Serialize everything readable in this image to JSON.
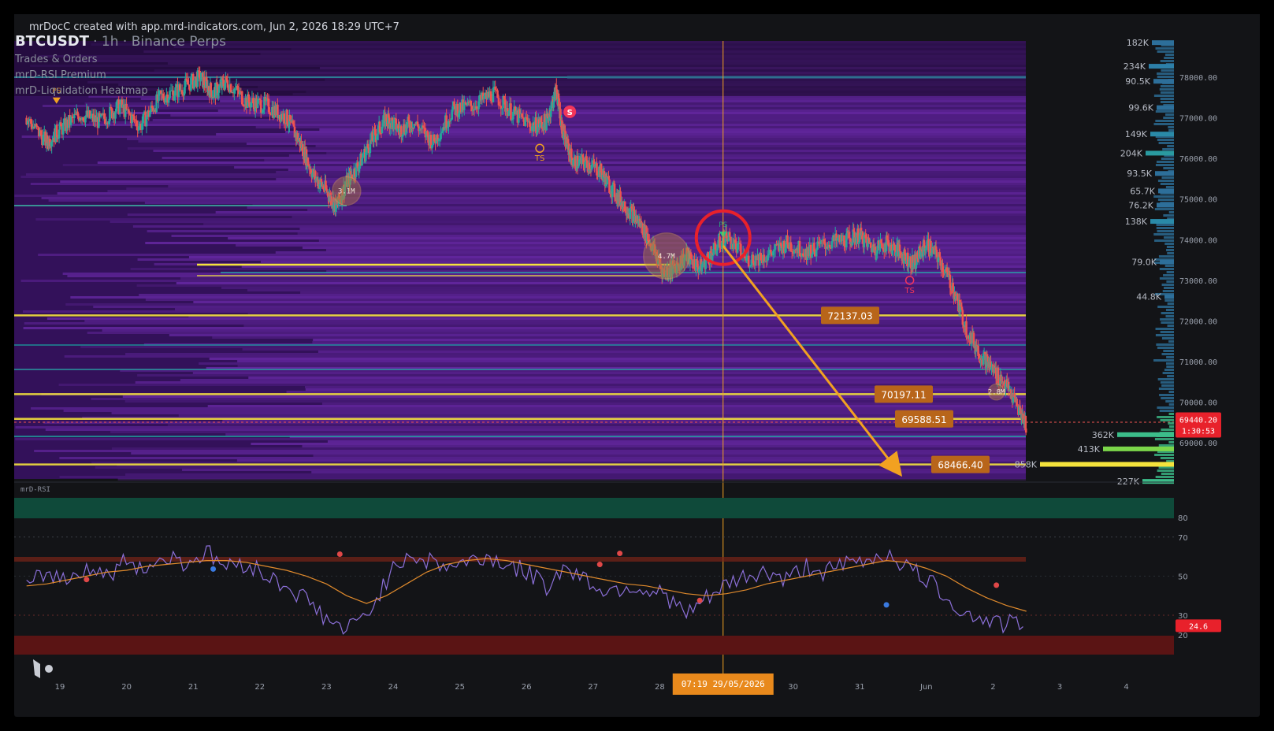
{
  "header": {
    "credit": "mrDocC  created with app.mrd-indicators.com, Jun 2, 2026 18:29 UTC+7"
  },
  "legend": {
    "symbol": "BTCUSDT",
    "timeframe": "· 1h · Binance Perps",
    "indicators": [
      "Trades & Orders",
      "mrD-RSI Premium",
      "mrD-Liquidation Heatmap"
    ]
  },
  "colors": {
    "background": "#131417",
    "heatmap_purple": "#4b1b78",
    "level_yellow": "#f5e33c",
    "arrow_orange": "#f2a121",
    "candle_up": "#26a69a",
    "candle_down": "#ef5350",
    "rsi_line": "#8b6fd8",
    "rsi_ma": "#e08a2c",
    "price_badge": "#e8212b",
    "crosshair_badge": "#e8891c"
  },
  "chart_data": {
    "type": "line",
    "title": "BTCUSDT",
    "x_ticks": [
      "19",
      "20",
      "21",
      "22",
      "23",
      "24",
      "25",
      "26",
      "27",
      "28",
      "30",
      "31",
      "Jun",
      "2",
      "3",
      "4"
    ],
    "y_ticks": [
      "78000.00",
      "77000.00",
      "76000.00",
      "75000.00",
      "74000.00",
      "73000.00",
      "72000.00",
      "71000.00",
      "70000.00",
      "69000.00"
    ],
    "ylim": [
      68000,
      79000
    ],
    "price_series": {
      "name": "BTCUSDT",
      "x_days": [
        18.5,
        18.8,
        19.0,
        19.3,
        19.6,
        19.9,
        20.2,
        20.5,
        20.8,
        21.1,
        21.3,
        21.5,
        21.8,
        22.1,
        22.4,
        22.6,
        22.8,
        23.0,
        23.15,
        23.3,
        23.5,
        23.7,
        23.9,
        24.1,
        24.3,
        24.6,
        24.9,
        25.2,
        25.5,
        25.8,
        26.1,
        26.3,
        26.45,
        26.55,
        26.7,
        26.9,
        27.1,
        27.3,
        27.5,
        27.7,
        27.9,
        28.05,
        28.2,
        28.4,
        28.6,
        28.8,
        29.0,
        29.3,
        29.6,
        29.9,
        30.2,
        30.5,
        30.8,
        31.0,
        31.2,
        31.4,
        31.6,
        31.8,
        32.0,
        32.2,
        32.4,
        32.6,
        32.8,
        33.0,
        33.2,
        33.4,
        33.5
      ],
      "y": [
        77000,
        76400,
        76700,
        77100,
        76900,
        77300,
        76800,
        77500,
        77700,
        78000,
        77600,
        77900,
        77400,
        77300,
        77000,
        76400,
        75600,
        75200,
        74800,
        75400,
        75900,
        76500,
        77000,
        76700,
        76900,
        76400,
        77200,
        77300,
        77600,
        77100,
        76800,
        76900,
        77700,
        76600,
        75900,
        75900,
        75700,
        75200,
        74800,
        74400,
        73800,
        73200,
        73300,
        73600,
        73300,
        73700,
        74100,
        73500,
        73600,
        73900,
        73700,
        73900,
        74000,
        74100,
        73800,
        73900,
        73700,
        73400,
        73900,
        73500,
        72800,
        71800,
        71200,
        70800,
        70400,
        69800,
        69440
      ]
    },
    "price_labels": [
      {
        "value": 72137.03,
        "label": "72137.03"
      },
      {
        "value": 70197.11,
        "label": "70197.11"
      },
      {
        "value": 69588.51,
        "label": "69588.51"
      },
      {
        "value": 68466.4,
        "label": "68466.40"
      }
    ],
    "last_price": {
      "label": "69440.20",
      "countdown": "1:30:53"
    },
    "volume_profile": [
      {
        "price": 78850,
        "label": "182K"
      },
      {
        "price": 78270,
        "label": "234K"
      },
      {
        "price": 77900,
        "label": "90.5K"
      },
      {
        "price": 77250,
        "label": "99.6K"
      },
      {
        "price": 76600,
        "label": "149K"
      },
      {
        "price": 76130,
        "label": "204K"
      },
      {
        "price": 75630,
        "label": "93.5K"
      },
      {
        "price": 75200,
        "label": "65.7K"
      },
      {
        "price": 74850,
        "label": "76.2K"
      },
      {
        "price": 74450,
        "label": "138K"
      },
      {
        "price": 73450,
        "label": "79.0K"
      },
      {
        "price": 72600,
        "label": "44.8K"
      },
      {
        "price": 69200,
        "label": "362K"
      },
      {
        "price": 68850,
        "label": "413K"
      },
      {
        "price": 68470,
        "label": "858K"
      },
      {
        "price": 68050,
        "label": "227K"
      }
    ],
    "liquidation_bubbles": [
      {
        "x_day": 23.3,
        "price": 75200,
        "label": "3.1M"
      },
      {
        "x_day": 28.1,
        "price": 73600,
        "label": "4.7M"
      },
      {
        "x_day": 33.05,
        "price": 70250,
        "label": "2.8M"
      }
    ],
    "signals": [
      {
        "type": "S",
        "x_day": 26.65,
        "price": 77150
      },
      {
        "type": "TS",
        "x_day": 26.2,
        "price": 76250
      },
      {
        "type": "TS",
        "x_day": 31.75,
        "price": 73000
      },
      {
        "type": "PS",
        "x_day": 18.95,
        "price": 77500
      },
      {
        "type": "PS",
        "x_day": 28.95,
        "price": 74200
      }
    ],
    "projection_arrow": {
      "from": {
        "x_day": 28.95,
        "price": 73850
      },
      "to": {
        "x_day": 31.55,
        "price": 68350
      }
    },
    "crosshair": {
      "x_day": 28.95,
      "time_label": "07:19   29/05/2026"
    },
    "rsi": {
      "title": "mrD-RSI",
      "ticks": [
        "80",
        "70",
        "50",
        "30",
        "20"
      ],
      "ylim": [
        10,
        100
      ],
      "current": "24.6",
      "x_days": [
        18.5,
        18.8,
        19.1,
        19.4,
        19.7,
        20.0,
        20.3,
        20.6,
        20.9,
        21.2,
        21.5,
        21.8,
        22.1,
        22.4,
        22.7,
        23.0,
        23.3,
        23.6,
        23.9,
        24.2,
        24.5,
        24.8,
        25.1,
        25.4,
        25.7,
        26.0,
        26.3,
        26.6,
        26.9,
        27.2,
        27.5,
        27.8,
        28.1,
        28.4,
        28.7,
        29.0,
        29.3,
        29.6,
        29.9,
        30.2,
        30.5,
        30.8,
        31.1,
        31.4,
        31.7,
        32.0,
        32.3,
        32.6,
        32.9,
        33.2,
        33.5
      ],
      "values": [
        44,
        52,
        48,
        55,
        50,
        58,
        54,
        60,
        57,
        62,
        55,
        57,
        50,
        45,
        38,
        28,
        22,
        30,
        48,
        62,
        58,
        55,
        57,
        60,
        56,
        52,
        45,
        55,
        48,
        42,
        45,
        43,
        40,
        30,
        38,
        45,
        50,
        52,
        48,
        55,
        52,
        56,
        58,
        62,
        55,
        48,
        40,
        30,
        28,
        25,
        27
      ],
      "ma": [
        45,
        46,
        48,
        50,
        52,
        53,
        55,
        56,
        57,
        58,
        58,
        57,
        55,
        53,
        50,
        46,
        40,
        36,
        40,
        46,
        52,
        56,
        58,
        59,
        58,
        56,
        54,
        52,
        50,
        48,
        46,
        45,
        43,
        41,
        40,
        41,
        43,
        46,
        48,
        50,
        52,
        54,
        56,
        58,
        57,
        54,
        50,
        44,
        39,
        35,
        32
      ]
    }
  }
}
